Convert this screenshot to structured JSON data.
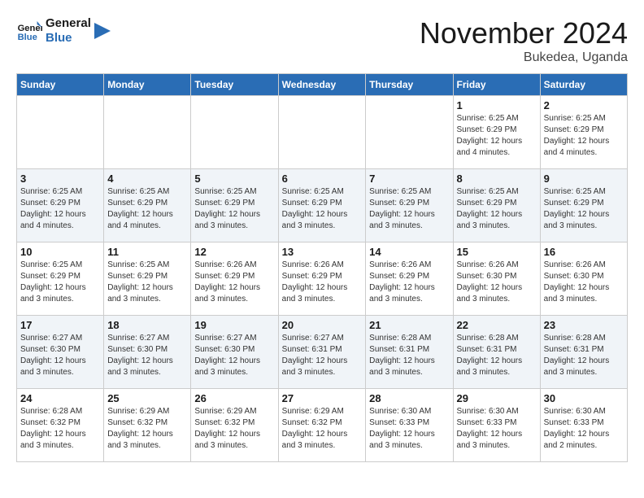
{
  "logo": {
    "text_general": "General",
    "text_blue": "Blue"
  },
  "title": {
    "month_year": "November 2024",
    "location": "Bukedea, Uganda"
  },
  "days_of_week": [
    "Sunday",
    "Monday",
    "Tuesday",
    "Wednesday",
    "Thursday",
    "Friday",
    "Saturday"
  ],
  "weeks": [
    [
      {
        "day": "",
        "info": ""
      },
      {
        "day": "",
        "info": ""
      },
      {
        "day": "",
        "info": ""
      },
      {
        "day": "",
        "info": ""
      },
      {
        "day": "",
        "info": ""
      },
      {
        "day": "1",
        "info": "Sunrise: 6:25 AM\nSunset: 6:29 PM\nDaylight: 12 hours and 4 minutes."
      },
      {
        "day": "2",
        "info": "Sunrise: 6:25 AM\nSunset: 6:29 PM\nDaylight: 12 hours and 4 minutes."
      }
    ],
    [
      {
        "day": "3",
        "info": "Sunrise: 6:25 AM\nSunset: 6:29 PM\nDaylight: 12 hours and 4 minutes."
      },
      {
        "day": "4",
        "info": "Sunrise: 6:25 AM\nSunset: 6:29 PM\nDaylight: 12 hours and 4 minutes."
      },
      {
        "day": "5",
        "info": "Sunrise: 6:25 AM\nSunset: 6:29 PM\nDaylight: 12 hours and 3 minutes."
      },
      {
        "day": "6",
        "info": "Sunrise: 6:25 AM\nSunset: 6:29 PM\nDaylight: 12 hours and 3 minutes."
      },
      {
        "day": "7",
        "info": "Sunrise: 6:25 AM\nSunset: 6:29 PM\nDaylight: 12 hours and 3 minutes."
      },
      {
        "day": "8",
        "info": "Sunrise: 6:25 AM\nSunset: 6:29 PM\nDaylight: 12 hours and 3 minutes."
      },
      {
        "day": "9",
        "info": "Sunrise: 6:25 AM\nSunset: 6:29 PM\nDaylight: 12 hours and 3 minutes."
      }
    ],
    [
      {
        "day": "10",
        "info": "Sunrise: 6:25 AM\nSunset: 6:29 PM\nDaylight: 12 hours and 3 minutes."
      },
      {
        "day": "11",
        "info": "Sunrise: 6:25 AM\nSunset: 6:29 PM\nDaylight: 12 hours and 3 minutes."
      },
      {
        "day": "12",
        "info": "Sunrise: 6:26 AM\nSunset: 6:29 PM\nDaylight: 12 hours and 3 minutes."
      },
      {
        "day": "13",
        "info": "Sunrise: 6:26 AM\nSunset: 6:29 PM\nDaylight: 12 hours and 3 minutes."
      },
      {
        "day": "14",
        "info": "Sunrise: 6:26 AM\nSunset: 6:29 PM\nDaylight: 12 hours and 3 minutes."
      },
      {
        "day": "15",
        "info": "Sunrise: 6:26 AM\nSunset: 6:30 PM\nDaylight: 12 hours and 3 minutes."
      },
      {
        "day": "16",
        "info": "Sunrise: 6:26 AM\nSunset: 6:30 PM\nDaylight: 12 hours and 3 minutes."
      }
    ],
    [
      {
        "day": "17",
        "info": "Sunrise: 6:27 AM\nSunset: 6:30 PM\nDaylight: 12 hours and 3 minutes."
      },
      {
        "day": "18",
        "info": "Sunrise: 6:27 AM\nSunset: 6:30 PM\nDaylight: 12 hours and 3 minutes."
      },
      {
        "day": "19",
        "info": "Sunrise: 6:27 AM\nSunset: 6:30 PM\nDaylight: 12 hours and 3 minutes."
      },
      {
        "day": "20",
        "info": "Sunrise: 6:27 AM\nSunset: 6:31 PM\nDaylight: 12 hours and 3 minutes."
      },
      {
        "day": "21",
        "info": "Sunrise: 6:28 AM\nSunset: 6:31 PM\nDaylight: 12 hours and 3 minutes."
      },
      {
        "day": "22",
        "info": "Sunrise: 6:28 AM\nSunset: 6:31 PM\nDaylight: 12 hours and 3 minutes."
      },
      {
        "day": "23",
        "info": "Sunrise: 6:28 AM\nSunset: 6:31 PM\nDaylight: 12 hours and 3 minutes."
      }
    ],
    [
      {
        "day": "24",
        "info": "Sunrise: 6:28 AM\nSunset: 6:32 PM\nDaylight: 12 hours and 3 minutes."
      },
      {
        "day": "25",
        "info": "Sunrise: 6:29 AM\nSunset: 6:32 PM\nDaylight: 12 hours and 3 minutes."
      },
      {
        "day": "26",
        "info": "Sunrise: 6:29 AM\nSunset: 6:32 PM\nDaylight: 12 hours and 3 minutes."
      },
      {
        "day": "27",
        "info": "Sunrise: 6:29 AM\nSunset: 6:32 PM\nDaylight: 12 hours and 3 minutes."
      },
      {
        "day": "28",
        "info": "Sunrise: 6:30 AM\nSunset: 6:33 PM\nDaylight: 12 hours and 3 minutes."
      },
      {
        "day": "29",
        "info": "Sunrise: 6:30 AM\nSunset: 6:33 PM\nDaylight: 12 hours and 3 minutes."
      },
      {
        "day": "30",
        "info": "Sunrise: 6:30 AM\nSunset: 6:33 PM\nDaylight: 12 hours and 2 minutes."
      }
    ]
  ]
}
